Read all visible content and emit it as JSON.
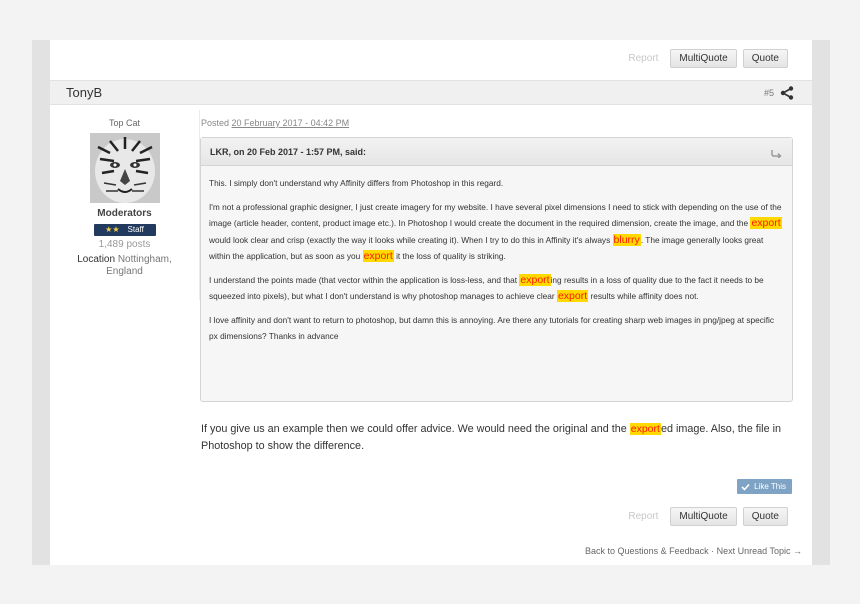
{
  "top_actions": {
    "report": "Report",
    "multiquote": "MultiQuote",
    "quote": "Quote"
  },
  "post": {
    "author": "TonyB",
    "number": "#5",
    "posted_prefix": "Posted ",
    "posted_date": "20 February 2017 - 04:42 PM"
  },
  "author_info": {
    "rank_title": "Top Cat",
    "group": "Moderators",
    "badge_stars": "★★",
    "badge_label": "Staff",
    "post_count": "1,489 posts",
    "location_label": "Location",
    "location_value_1": "Nottingham,",
    "location_value_2": "England"
  },
  "quote": {
    "header": "LKR, on 20 Feb 2017 - 1:57 PM, said:",
    "p1": "This. I simply don't understand why Affinity differs from Photoshop in this regard.",
    "p2_a": "I'm not a professional graphic designer, I just create imagery for my website. I have several pixel dimensions I need to stick with depending on the use of the image (article header, content, product image etc.). In Photoshop I would create the document in the required dimension, create the image, and the ",
    "p2_hl1": "export",
    "p2_b": " would look clear and crisp (exactly the way it looks while creating it). When I try to do this in Affinity it's always ",
    "p2_hl2": "blurry",
    "p2_c": ". The image generally looks great within the application, but as soon as you ",
    "p2_hl3": "export",
    "p2_d": " it the loss of quality is striking.",
    "p3_a": "I understand the points made (that vector within the application is loss-less, and that ",
    "p3_hl1": "export",
    "p3_b": "ing results in a loss of quality due to the fact it needs to be squeezed into pixels), but what I don't understand is why photoshop manages to achieve clear ",
    "p3_hl2": "export",
    "p3_c": " results while affinity does not.",
    "p4": "I love affinity and don't want to return to photoshop, but damn this is annoying. Are there any tutorials for creating sharp web images in png/jpeg at specific px dimensions? Thanks in advance"
  },
  "reply": {
    "a": "If you give us an example then we could offer advice. We would need the original and the ",
    "hl": "export",
    "b": "ed image. Also, the file in Photoshop to show the difference."
  },
  "like_label": "Like This",
  "bottom_actions": {
    "report": "Report",
    "multiquote": "MultiQuote",
    "quote": "Quote"
  },
  "footer": {
    "back_link": "Back to Questions & Feedback",
    "separator": " · ",
    "next_link": "Next Unread Topic",
    "next_arrow": " →"
  },
  "colors": {
    "highlight_bg": "#ffd900",
    "highlight_text": "#ff1a00",
    "badge_bg": "#223a5e",
    "like_bg": "#7fa3c5"
  },
  "icons": {
    "share": "share-icon",
    "quote_return": "quote-return-icon",
    "like": "check-icon"
  }
}
